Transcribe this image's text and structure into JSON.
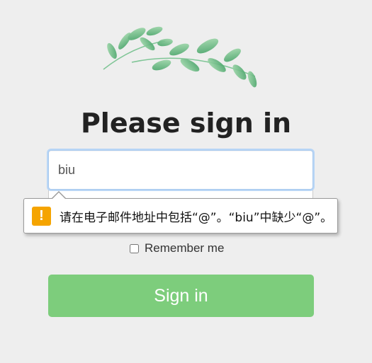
{
  "heading": "Please sign in",
  "email_field": {
    "value": "biu"
  },
  "validation_tooltip": {
    "message": "请在电子邮件地址中包括“@”。“biu”中缺少“@”。",
    "icon": "warning-icon"
  },
  "remember_me": {
    "label": "Remember me",
    "checked": false
  },
  "signin_button": {
    "label": "Sign in"
  },
  "logo": {
    "icon": "leaf-branch-icon"
  },
  "colors": {
    "background": "#eeeeee",
    "button": "#7dcd7c",
    "warning": "#f5a400",
    "focus_ring": "#b9d6f6"
  }
}
